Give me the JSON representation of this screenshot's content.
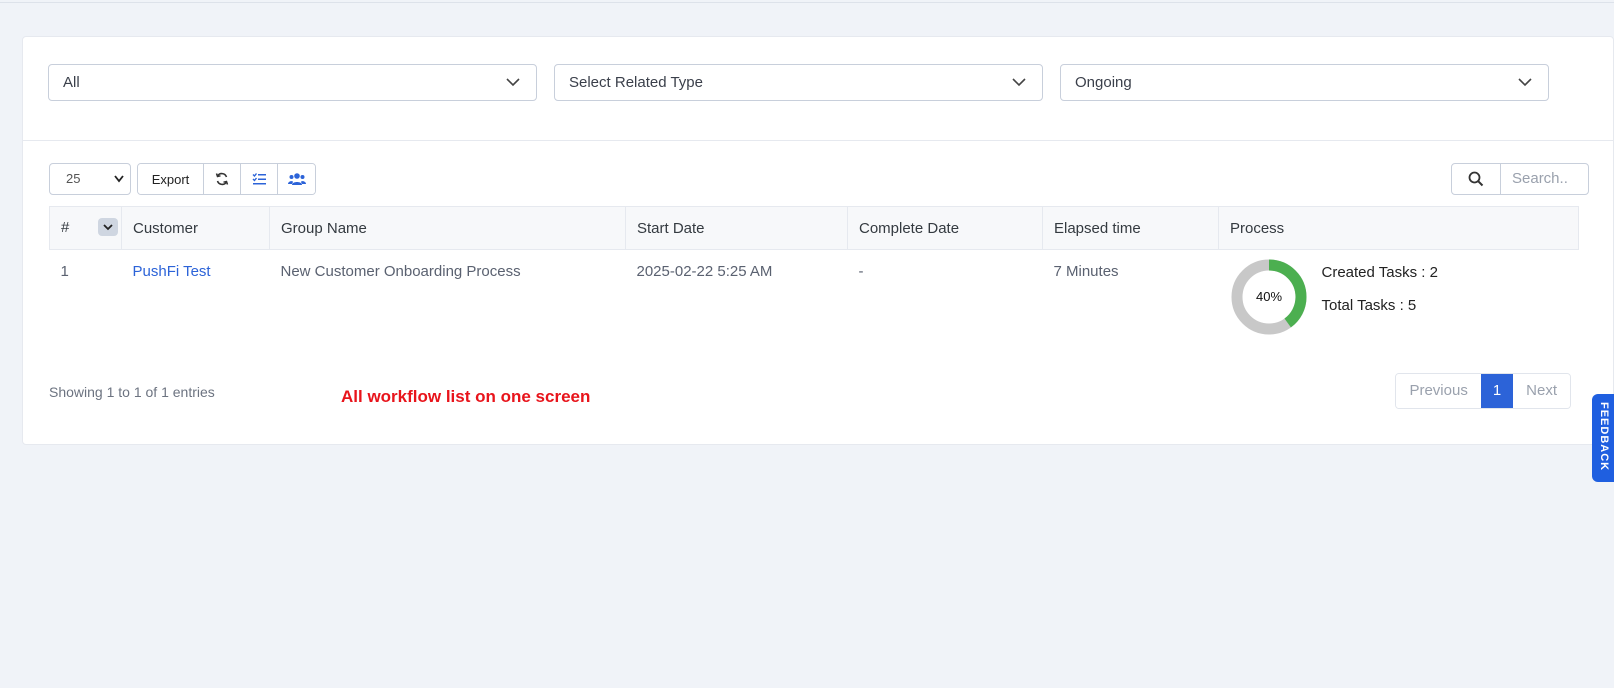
{
  "filters": {
    "select1": "All",
    "select2": "Select Related Type",
    "select3": "Ongoing"
  },
  "toolbar": {
    "page_length": "25",
    "export_label": "Export",
    "search_placeholder": "Search.."
  },
  "table": {
    "headers": [
      "#",
      "Customer",
      "Group Name",
      "Start Date",
      "Complete Date",
      "Elapsed time",
      "Process"
    ],
    "rows": [
      {
        "num": "1",
        "customer": "PushFi Test",
        "group_name": "New Customer Onboarding Process",
        "start_date": "2025-02-22 5:25 AM",
        "complete_date": "-",
        "elapsed": "7 Minutes",
        "progress_label": "40%",
        "progress_value": 0.4,
        "created_tasks": "Created Tasks : 2",
        "total_tasks": "Total Tasks : 5"
      }
    ]
  },
  "footer": {
    "info": "Showing 1 to 1 of 1 entries",
    "note": "All workflow list on one screen",
    "prev": "Previous",
    "page": "1",
    "next": "Next"
  },
  "sidetab": {
    "label": "FEEDBACK"
  },
  "colors": {
    "accent": "#2c63d8",
    "progress": "#4caf50",
    "track": "#c8c8c8",
    "note": "#e8141b"
  }
}
